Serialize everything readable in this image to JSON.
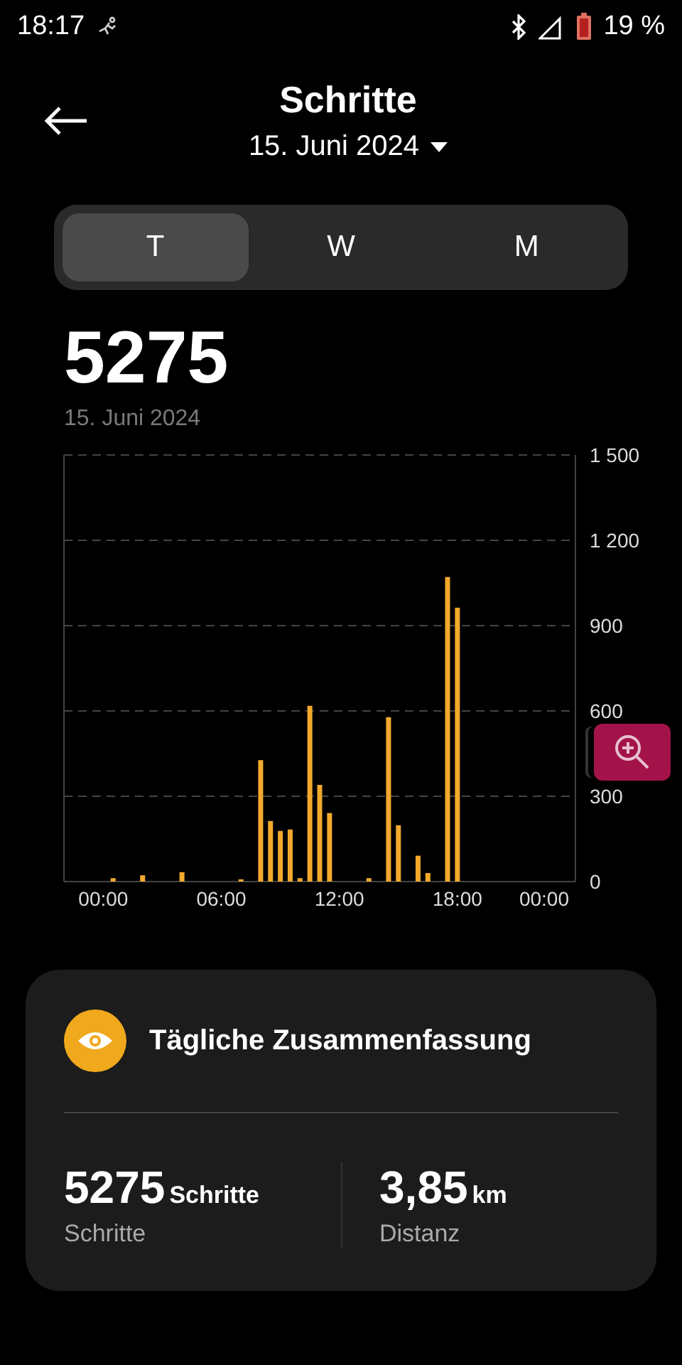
{
  "status_bar": {
    "time": "18:17",
    "battery": "19 %"
  },
  "header": {
    "title": "Schritte",
    "date": "15. Juni 2024"
  },
  "tabs": [
    {
      "label": "T",
      "selected": true
    },
    {
      "label": "W",
      "selected": false
    },
    {
      "label": "M",
      "selected": false
    }
  ],
  "total": {
    "value": "5275",
    "date": "15. Juni 2024"
  },
  "chart": {
    "chart_data": {
      "type": "bar",
      "x": [
        0.5,
        2,
        4,
        7,
        8,
        8.5,
        9,
        9.5,
        10,
        10.5,
        11,
        11.5,
        13.5,
        14.5,
        15,
        16,
        16.5,
        17.5,
        18
      ],
      "grid": true,
      "series": [
        {
          "color": "#f2a92c",
          "values": [
            12,
            22,
            33,
            8,
            427,
            213,
            178,
            183,
            12,
            618,
            340,
            241,
            12,
            578,
            198,
            91,
            30,
            1071,
            963
          ]
        }
      ],
      "xlim": [
        -2,
        24
      ],
      "ylim": [
        0,
        1500
      ],
      "xticks": [
        {
          "value": 0,
          "label": "00:00"
        },
        {
          "value": 6,
          "label": "06:00"
        },
        {
          "value": 12,
          "label": "12:00"
        },
        {
          "value": 18,
          "label": "18:00"
        },
        {
          "value": 24,
          "label": "00:00"
        }
      ],
      "yticks": [
        {
          "value": 0,
          "label": "0"
        },
        {
          "value": 300,
          "label": "300"
        },
        {
          "value": 600,
          "label": "600"
        },
        {
          "value": 900,
          "label": "900"
        },
        {
          "value": 1200,
          "label": "1 200"
        },
        {
          "value": 1500,
          "label": "1 500"
        }
      ]
    }
  },
  "summary": {
    "title": "Tägliche Zusammenfassung",
    "stats": [
      {
        "value": "5275",
        "unit": "Schritte",
        "label": "Schritte"
      },
      {
        "value": "3,85",
        "unit": "km",
        "label": "Distanz"
      }
    ]
  }
}
